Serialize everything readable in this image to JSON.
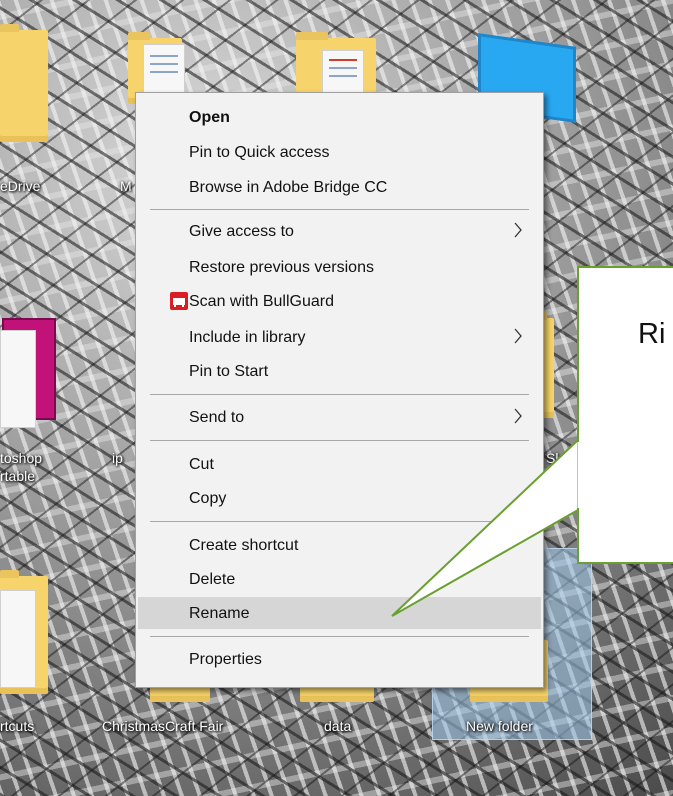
{
  "desktop": {
    "icons": [
      {
        "label": "eDrive"
      },
      {
        "label": "M"
      },
      {
        "label": "toshop"
      },
      {
        "label": "rtable"
      },
      {
        "label": "ip"
      },
      {
        "label": "Sl"
      },
      {
        "label": "rtcuts"
      },
      {
        "label": "ChristmasCraft Fair"
      },
      {
        "label": "data"
      },
      {
        "label": "New folder"
      }
    ]
  },
  "context_menu": {
    "items": [
      {
        "label": "Open"
      },
      {
        "label": "Pin to Quick access"
      },
      {
        "label": "Browse in Adobe Bridge CC"
      },
      {
        "label": "Give access to"
      },
      {
        "label": "Restore previous versions"
      },
      {
        "label": "Scan with BullGuard",
        "icon": "bullguard-icon"
      },
      {
        "label": "Include in library"
      },
      {
        "label": "Pin to Start"
      },
      {
        "label": "Send to"
      },
      {
        "label": "Cut"
      },
      {
        "label": "Copy"
      },
      {
        "label": "Create shortcut"
      },
      {
        "label": "Delete"
      },
      {
        "label": "Rename"
      },
      {
        "label": "Properties"
      }
    ],
    "hovered": "Rename"
  },
  "callout": {
    "text": "Ri"
  },
  "colors": {
    "callout_border": "#6aa030",
    "bullguard_red": "#d91d23",
    "menu_bg": "#f2f2f2"
  }
}
